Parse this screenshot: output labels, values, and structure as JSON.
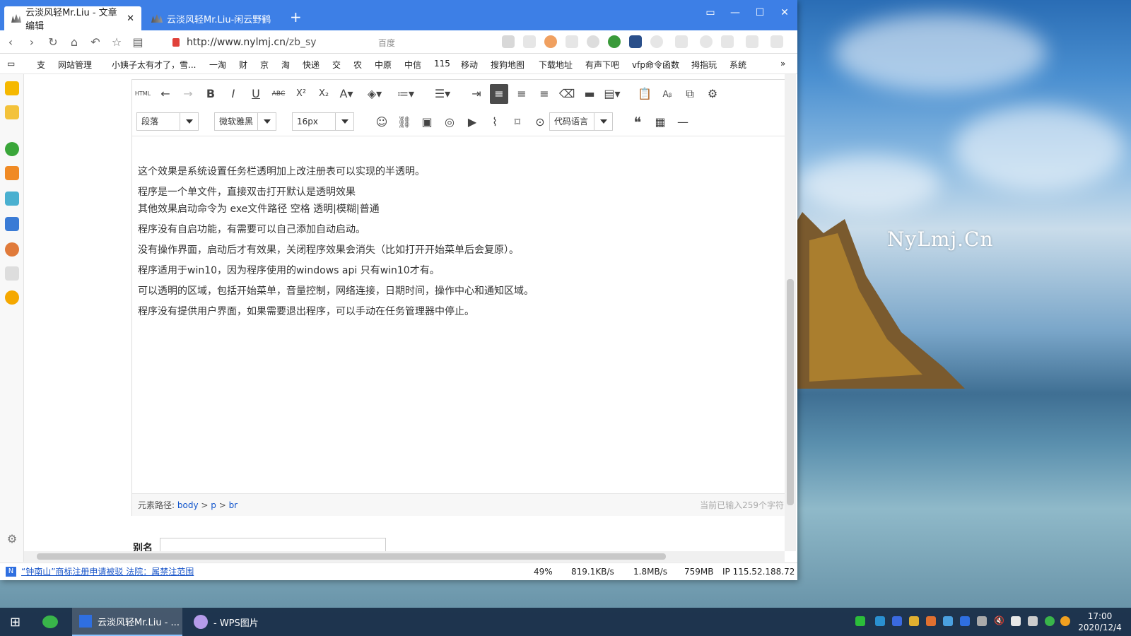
{
  "browser": {
    "tabs": [
      {
        "label": "云淡风轻Mr.Liu - 文章编辑",
        "active": true
      },
      {
        "label": "云淡风轻Mr.Liu-闲云野鹤",
        "active": false
      }
    ],
    "url_domain": "http://www.nylmj.cn",
    "url_path": "/zb_sy",
    "search_hint": "百度",
    "bookmarks": [
      "支",
      "网站管理",
      "小姨子太有才了，雪...",
      "一淘",
      "财",
      "京",
      "淘",
      "快递",
      "交",
      "农",
      "中原",
      "中信",
      "115",
      "移动",
      "搜狗地图",
      "下载地址",
      "有声下吧",
      "vfp命令函数",
      "拇指玩",
      "系统"
    ]
  },
  "editor": {
    "paragraph_select": "段落",
    "font_select": "微软雅黑",
    "size_select": "16px",
    "code_select": "代码语言",
    "html_label": "HTML",
    "paragraphs": [
      "这个效果是系统设置任务栏透明加上改注册表可以实现的半透明。",
      "程序是一个单文件，直接双击打开默认是透明效果",
      "其他效果启动命令为   exe文件路径 空格 透明|模糊|普通",
      "程序没有自启功能，有需要可以自己添加自动启动。",
      "没有操作界面，启动后才有效果，关闭程序效果会消失（比如打开开始菜单后会复原）。",
      "程序适用于win10，因为程序使用的windows api 只有win10才有。",
      "可以透明的区域，包括开始菜单，音量控制，网络连接，日期时间，操作中心和通知区域。",
      "程序没有提供用户界面，如果需要退出程序，可以手动在任务管理器中停止。"
    ],
    "path_label": "元素路径:",
    "path": [
      "body",
      "p",
      "br"
    ],
    "char_count": "当前已输入259个字符"
  },
  "form": {
    "alias_label": "别名"
  },
  "status": {
    "news": "“钟南山”商标注册申请被驳 法院：属禁注范围",
    "cpu": "49%",
    "down": "819.1KB/s",
    "up": "1.8MB/s",
    "mem": "759MB",
    "ip": "IP 115.52.188.72"
  },
  "taskbar": {
    "app1": "云淡风轻Mr.Liu - ...",
    "app2": "- WPS图片",
    "time": "17:00",
    "date": "2020/12/4"
  },
  "desktop": {
    "watermark": "NyLmj.Cn"
  }
}
